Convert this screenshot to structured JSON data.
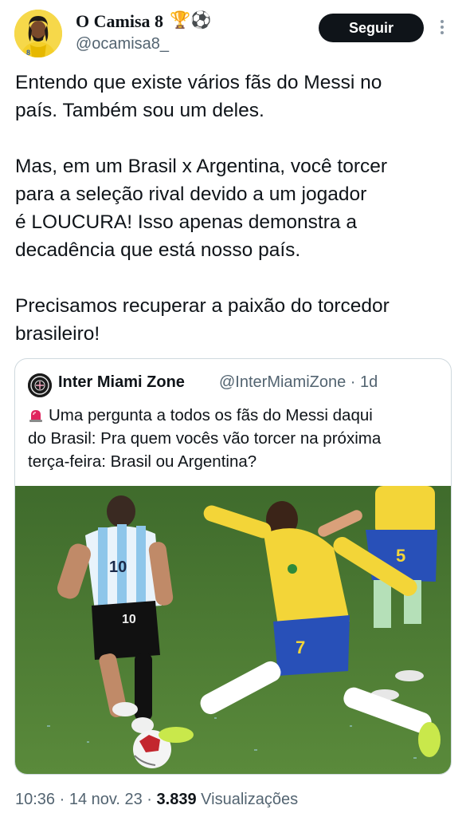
{
  "author": {
    "name": "O Camisa 8",
    "emojis": "🏆⚽",
    "handle": "@ocamisa8_",
    "avatar_icon": "player-avatar-icon"
  },
  "follow_label": "Seguir",
  "tweet": {
    "lines_p1": [
      "Entendo que existe vários fãs do Messi no",
      "país. Também sou um deles."
    ],
    "lines_p2": [
      "Mas, em um Brasil x Argentina, você torcer",
      "para a seleção rival devido a um jogador",
      "é LOUCURA! Isso apenas demonstra a",
      "decadência que está nosso país."
    ],
    "lines_p3": [
      "Precisamos recuperar a paixão do torcedor",
      "brasileiro!"
    ]
  },
  "quoted": {
    "name": "Inter Miami Zone",
    "handle_time": "@InterMiamiZone · 1d",
    "icon": "siren-icon",
    "lines": [
      "Uma pergunta a todos os fãs do Messi daqui",
      "do Brasil: Pra quem vocês vão torcer na próxima",
      "terça-feira: Brasil ou Argentina?"
    ],
    "jersey_numbers": [
      "10",
      "10",
      "7",
      "5"
    ]
  },
  "meta": {
    "time_date": "10:36 · 14 nov. 23 · ",
    "views_count": "3.839",
    "views_label": " Visualizações"
  },
  "colors": {
    "argentina_light": "#a9d3ef",
    "brazil_yellow": "#f3d538",
    "brazil_blue": "#2850b8",
    "pitch": "#4b7a34"
  }
}
